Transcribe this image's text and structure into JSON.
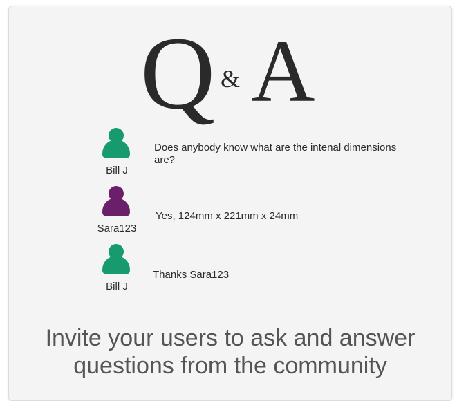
{
  "title": {
    "left": "Q",
    "amp": "&",
    "right": "A"
  },
  "colors": {
    "green": "#179b6e",
    "purple": "#6b1f6a"
  },
  "messages": [
    {
      "user": "Bill J",
      "avatar_color": "green",
      "text": "Does anybody know what are the intenal dimensions are?"
    },
    {
      "user": "Sara123",
      "avatar_color": "purple",
      "text": "Yes, 124mm x 221mm x 24mm"
    },
    {
      "user": "Bill J",
      "avatar_color": "green",
      "text": "Thanks Sara123"
    }
  ],
  "tagline": {
    "line1": "Invite your users to ask and answer",
    "line2": "questions from the community"
  }
}
